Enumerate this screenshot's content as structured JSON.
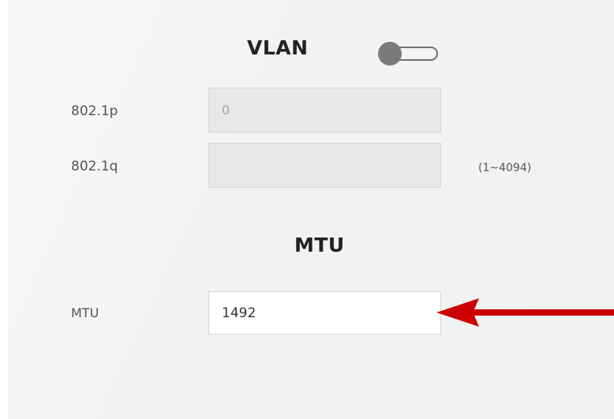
{
  "vlan": {
    "title": "VLAN",
    "enabled": false,
    "p8021p": {
      "label": "802.1p",
      "value": "0"
    },
    "q8021q": {
      "label": "802.1q",
      "value": "",
      "range_hint": "(1~4094)"
    }
  },
  "mtu": {
    "title": "MTU",
    "label": "MTU",
    "value": "1492"
  },
  "annotation": {
    "arrow_color": "#cc0000"
  }
}
